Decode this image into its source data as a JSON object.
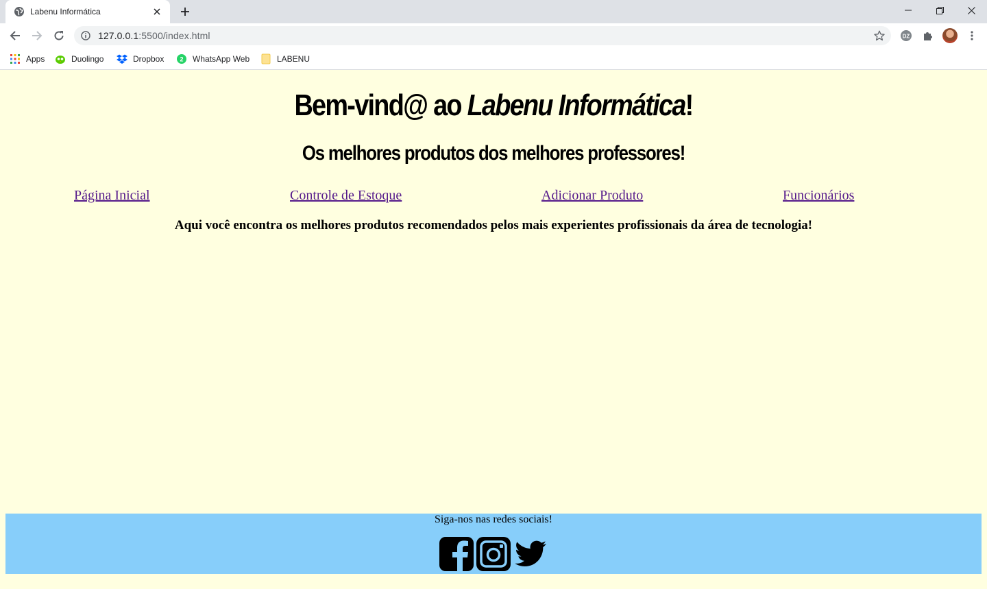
{
  "browser": {
    "tab_title": "Labenu Informática",
    "url_host": "127.0.0.1",
    "url_path": ":5500/index.html",
    "bookmarks": [
      {
        "label": "Apps",
        "icon": "apps-grid-icon"
      },
      {
        "label": "Duolingo",
        "icon": "duolingo-icon"
      },
      {
        "label": "Dropbox",
        "icon": "dropbox-icon"
      },
      {
        "label": "WhatsApp Web",
        "icon": "whatsapp-icon",
        "badge": "2"
      },
      {
        "label": "LABENU",
        "icon": "folder-icon"
      }
    ]
  },
  "header": {
    "title_prefix": "Bem-vind@ ao ",
    "title_brand": "Labenu Informática",
    "title_suffix": "!",
    "subtitle": "Os melhores produtos dos melhores professores!"
  },
  "nav": {
    "links": [
      {
        "label": "Página Inicial"
      },
      {
        "label": "Controle de Estoque"
      },
      {
        "label": "Adicionar Produto"
      },
      {
        "label": "Funcionários"
      }
    ]
  },
  "main": {
    "intro": "Aqui você encontra os melhores produtos recomendados pelos mais experientes profissionais da área de tecnologia!"
  },
  "footer": {
    "text": "Siga-nos nas redes sociais!",
    "social": [
      "facebook-icon",
      "instagram-icon",
      "twitter-icon"
    ]
  },
  "colors": {
    "page_background": "#ffffe0",
    "footer_background": "#87cefa",
    "link_visited": "#551a8b"
  }
}
